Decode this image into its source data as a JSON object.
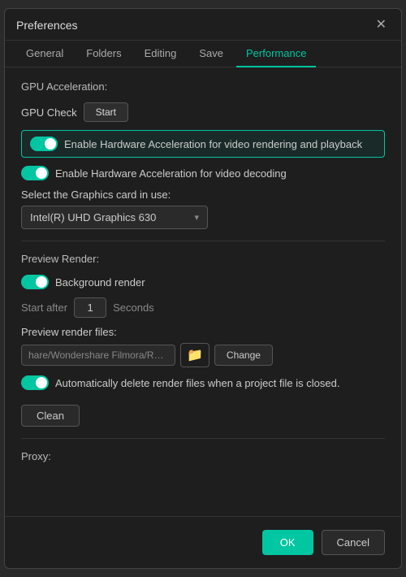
{
  "dialog": {
    "title": "Preferences",
    "close_label": "✕"
  },
  "tabs": [
    {
      "id": "general",
      "label": "General",
      "active": false
    },
    {
      "id": "folders",
      "label": "Folders",
      "active": false
    },
    {
      "id": "editing",
      "label": "Editing",
      "active": false
    },
    {
      "id": "save",
      "label": "Save",
      "active": false
    },
    {
      "id": "performance",
      "label": "Performance",
      "active": true
    }
  ],
  "gpu_section": {
    "label": "GPU Acceleration:",
    "gpu_check_label": "GPU Check",
    "start_label": "Start",
    "hw_accel_video_label": "Enable Hardware Acceleration for video rendering and playback",
    "hw_accel_decode_label": "Enable Hardware Acceleration for video decoding",
    "select_card_label": "Select the Graphics card in use:",
    "selected_card": "Intel(R) UHD Graphics 630"
  },
  "preview_section": {
    "label": "Preview Render:",
    "bg_render_label": "Background render",
    "start_after_label": "Start after",
    "start_after_value": "1",
    "seconds_label": "Seconds",
    "files_label": "Preview render files:",
    "path_value": "hare/Wondershare Filmora/Render",
    "change_label": "Change",
    "auto_delete_label": "Automatically delete render files when a project file is closed.",
    "clean_label": "Clean"
  },
  "proxy_section": {
    "label": "Proxy:"
  },
  "footer": {
    "ok_label": "OK",
    "cancel_label": "Cancel"
  },
  "icons": {
    "folder": "📁",
    "chevron_down": "▾"
  }
}
